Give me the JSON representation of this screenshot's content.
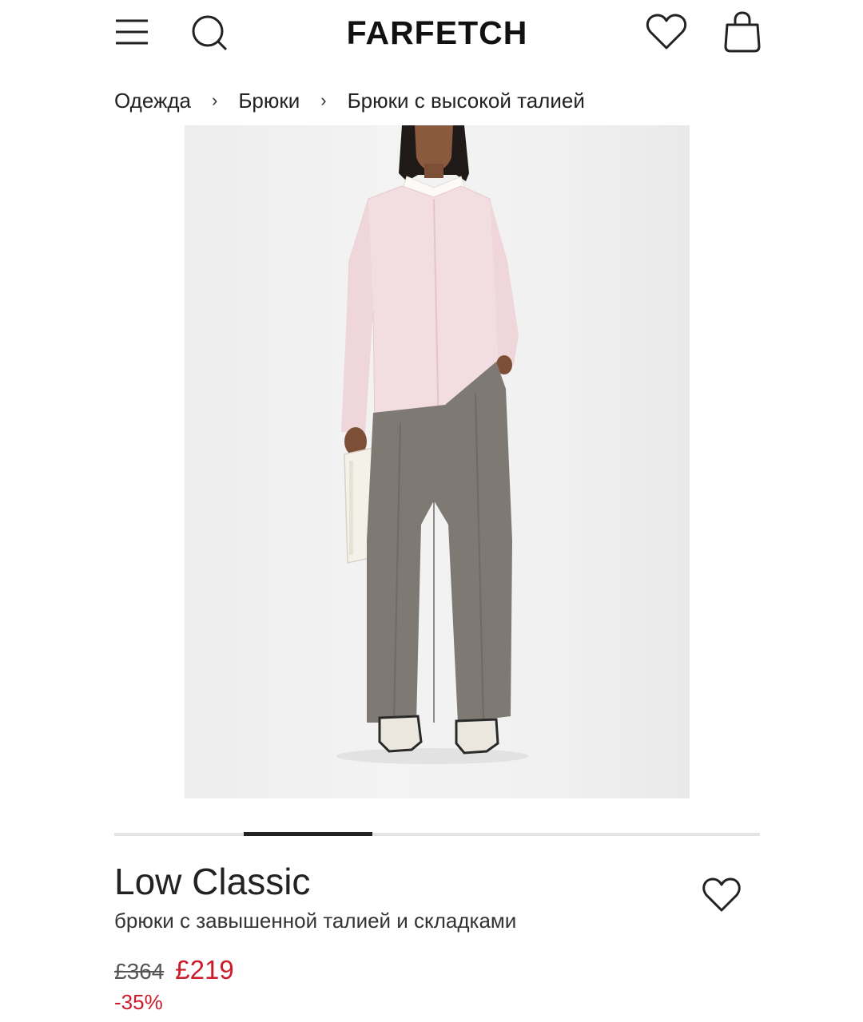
{
  "header": {
    "logo": "FARFETCH",
    "menu_icon": "hamburger-menu-icon",
    "search_icon": "search-icon",
    "wishlist_icon": "heart-icon",
    "bag_icon": "shopping-bag-icon"
  },
  "breadcrumb": {
    "items": [
      "Одежда",
      "Брюки",
      "Брюки с высокой талией"
    ],
    "separator": "›"
  },
  "carousel": {
    "total_slides": 5,
    "active_slide": 2
  },
  "product": {
    "brand": "Low Classic",
    "description": "брюки с завышенной талией и складками",
    "old_price": "£364",
    "new_price": "£219",
    "discount": "-35%"
  },
  "colors": {
    "sale_red": "#cc1b2b",
    "text": "#222222"
  }
}
